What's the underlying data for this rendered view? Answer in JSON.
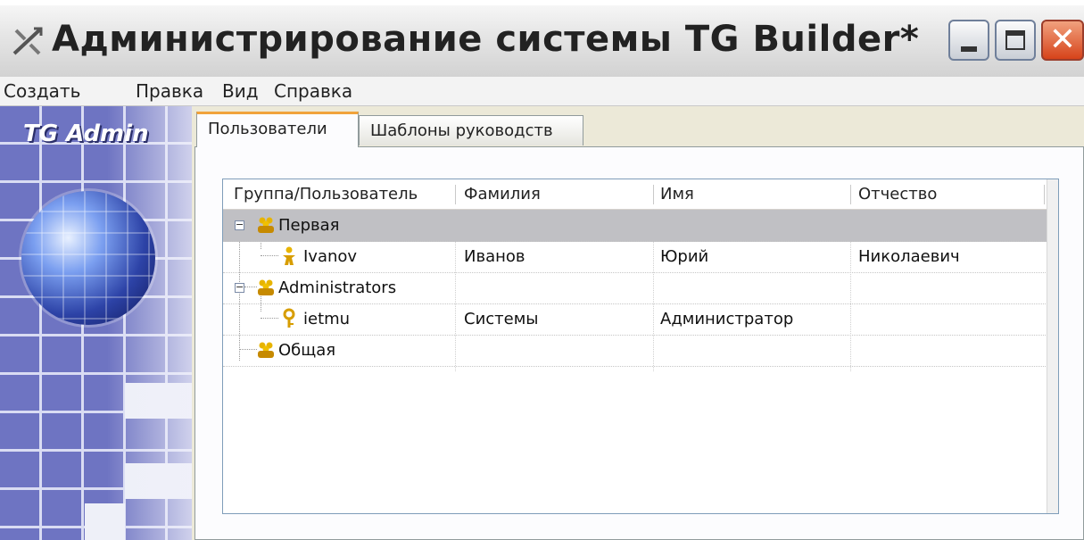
{
  "window": {
    "title": "Администрирование системы TG Builder*",
    "close_glyph": "✕"
  },
  "menu": [
    "Создать",
    "Правка",
    "Вид",
    "Справка"
  ],
  "sidebar": {
    "logo": "TG Admin"
  },
  "tabs": [
    {
      "label": "Пользователи",
      "active": true
    },
    {
      "label": "Шаблоны руководств",
      "active": false
    }
  ],
  "table": {
    "columns": [
      "Группа/Пользователь",
      "Фамилия",
      "Имя",
      "Отчество"
    ],
    "rows": [
      {
        "name": "Первая",
        "type": "group",
        "surname": "",
        "first": "",
        "middle": "",
        "selected": true,
        "icon": "group-icon"
      },
      {
        "name": "Ivanov",
        "type": "user",
        "surname": "Иванов",
        "first": "Юрий",
        "middle": "Николаевич",
        "icon": "user-icon"
      },
      {
        "name": "Administrators",
        "type": "group",
        "surname": "",
        "first": "",
        "middle": "",
        "icon": "group-icon"
      },
      {
        "name": "ietmu",
        "type": "admin",
        "surname": "Системы",
        "first": "Администратор",
        "middle": "",
        "icon": "key-icon"
      },
      {
        "name": "Общая",
        "type": "group",
        "surname": "",
        "first": "",
        "middle": "",
        "icon": "group-icon"
      }
    ]
  },
  "colors": {
    "selection": "#c0c0c4",
    "tab_accent": "#f1a33b",
    "sidebar": "#6e74c2"
  }
}
